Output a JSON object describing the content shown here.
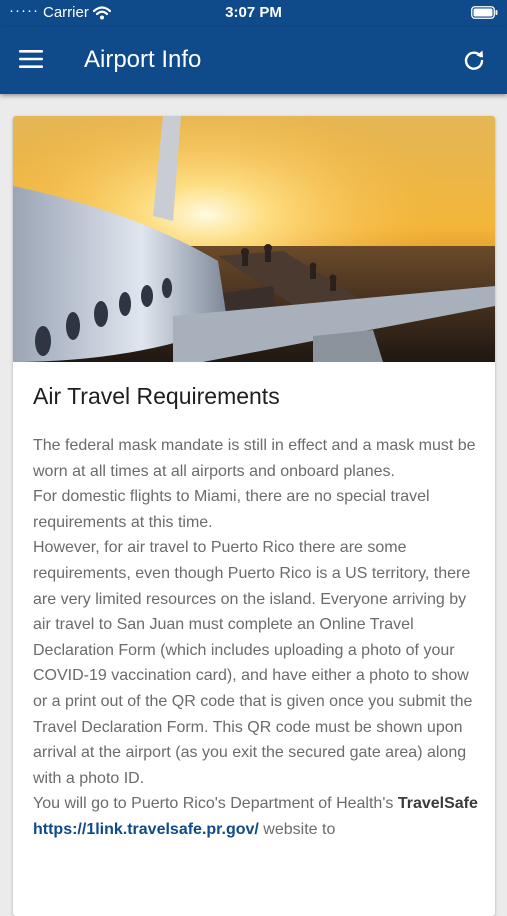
{
  "status_bar": {
    "carrier": "Carrier",
    "time": "3:07 PM"
  },
  "header": {
    "title": "Airport Info"
  },
  "article": {
    "title": "Air Travel Requirements",
    "paragraph1": "The federal mask mandate is still in effect and a mask must be worn at all times at all airports and onboard planes.",
    "paragraph2": "For domestic flights to Miami, there are no special travel requirements at this time.",
    "paragraph3": "However, for air travel to Puerto Rico there are some requirements, even though Puerto Rico is a US territory, there are very limited resources on the island. Everyone arriving by air travel to San Juan must complete an Online Travel Declaration Form (which includes uploading a photo of your COVID-19 vaccination card), and have either a photo to show or a print out of the QR code that is given once you submit the Travel Declaration Form. This QR code must be shown upon arrival at the airport (as you exit the secured gate area) along with a photo ID.",
    "paragraph4_prefix": "You will go to Puerto Rico's Department of Health's",
    "paragraph4_strong": "TravelSafe",
    "paragraph4_link": "https://1link.travelsafe.pr.gov/",
    "paragraph4_suffix": "website to"
  },
  "colors": {
    "header_bg": "#0f4a8a",
    "link": "#0f4a8a",
    "body_text": "#6b6b6b",
    "background": "#ebebeb"
  },
  "icons": {
    "menu": "hamburger-menu-icon",
    "refresh": "refresh-icon",
    "wifi": "wifi-icon",
    "battery": "battery-icon"
  }
}
